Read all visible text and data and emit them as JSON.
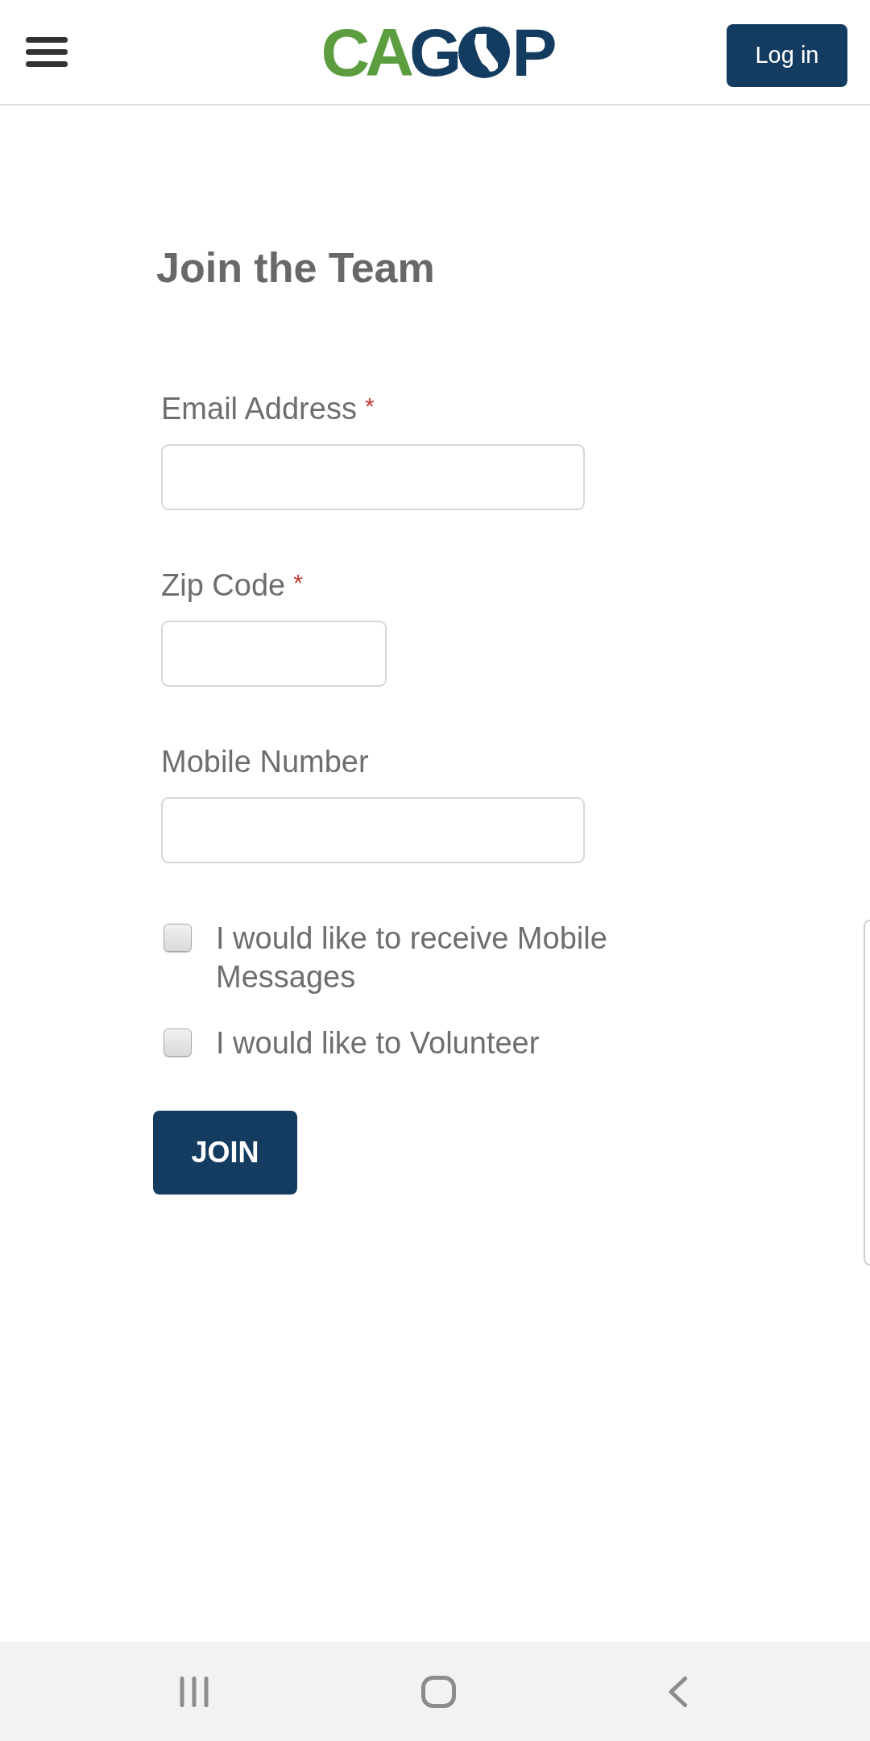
{
  "header": {
    "logo": {
      "segments": [
        {
          "kind": "text",
          "text": "CA",
          "color": "#5c9e3f"
        },
        {
          "kind": "text",
          "text": "G",
          "color": "#143c61"
        },
        {
          "kind": "emblem",
          "color": "#143c61"
        },
        {
          "kind": "text",
          "text": "P",
          "color": "#143c61"
        }
      ]
    },
    "login_button": "Log in"
  },
  "form": {
    "title": "Join the Team",
    "required_mark": "*",
    "fields": [
      {
        "label": "Email Address",
        "required": true,
        "kind": "wide"
      },
      {
        "label": "Zip Code",
        "required": true,
        "kind": "short"
      },
      {
        "label": "Mobile Number",
        "required": false,
        "kind": "wide"
      }
    ],
    "options": [
      {
        "label": "I would like to receive Mobile Messages",
        "checked": false
      },
      {
        "label": "I would like to Volunteer",
        "checked": false
      }
    ],
    "submit_button": "JOIN"
  }
}
